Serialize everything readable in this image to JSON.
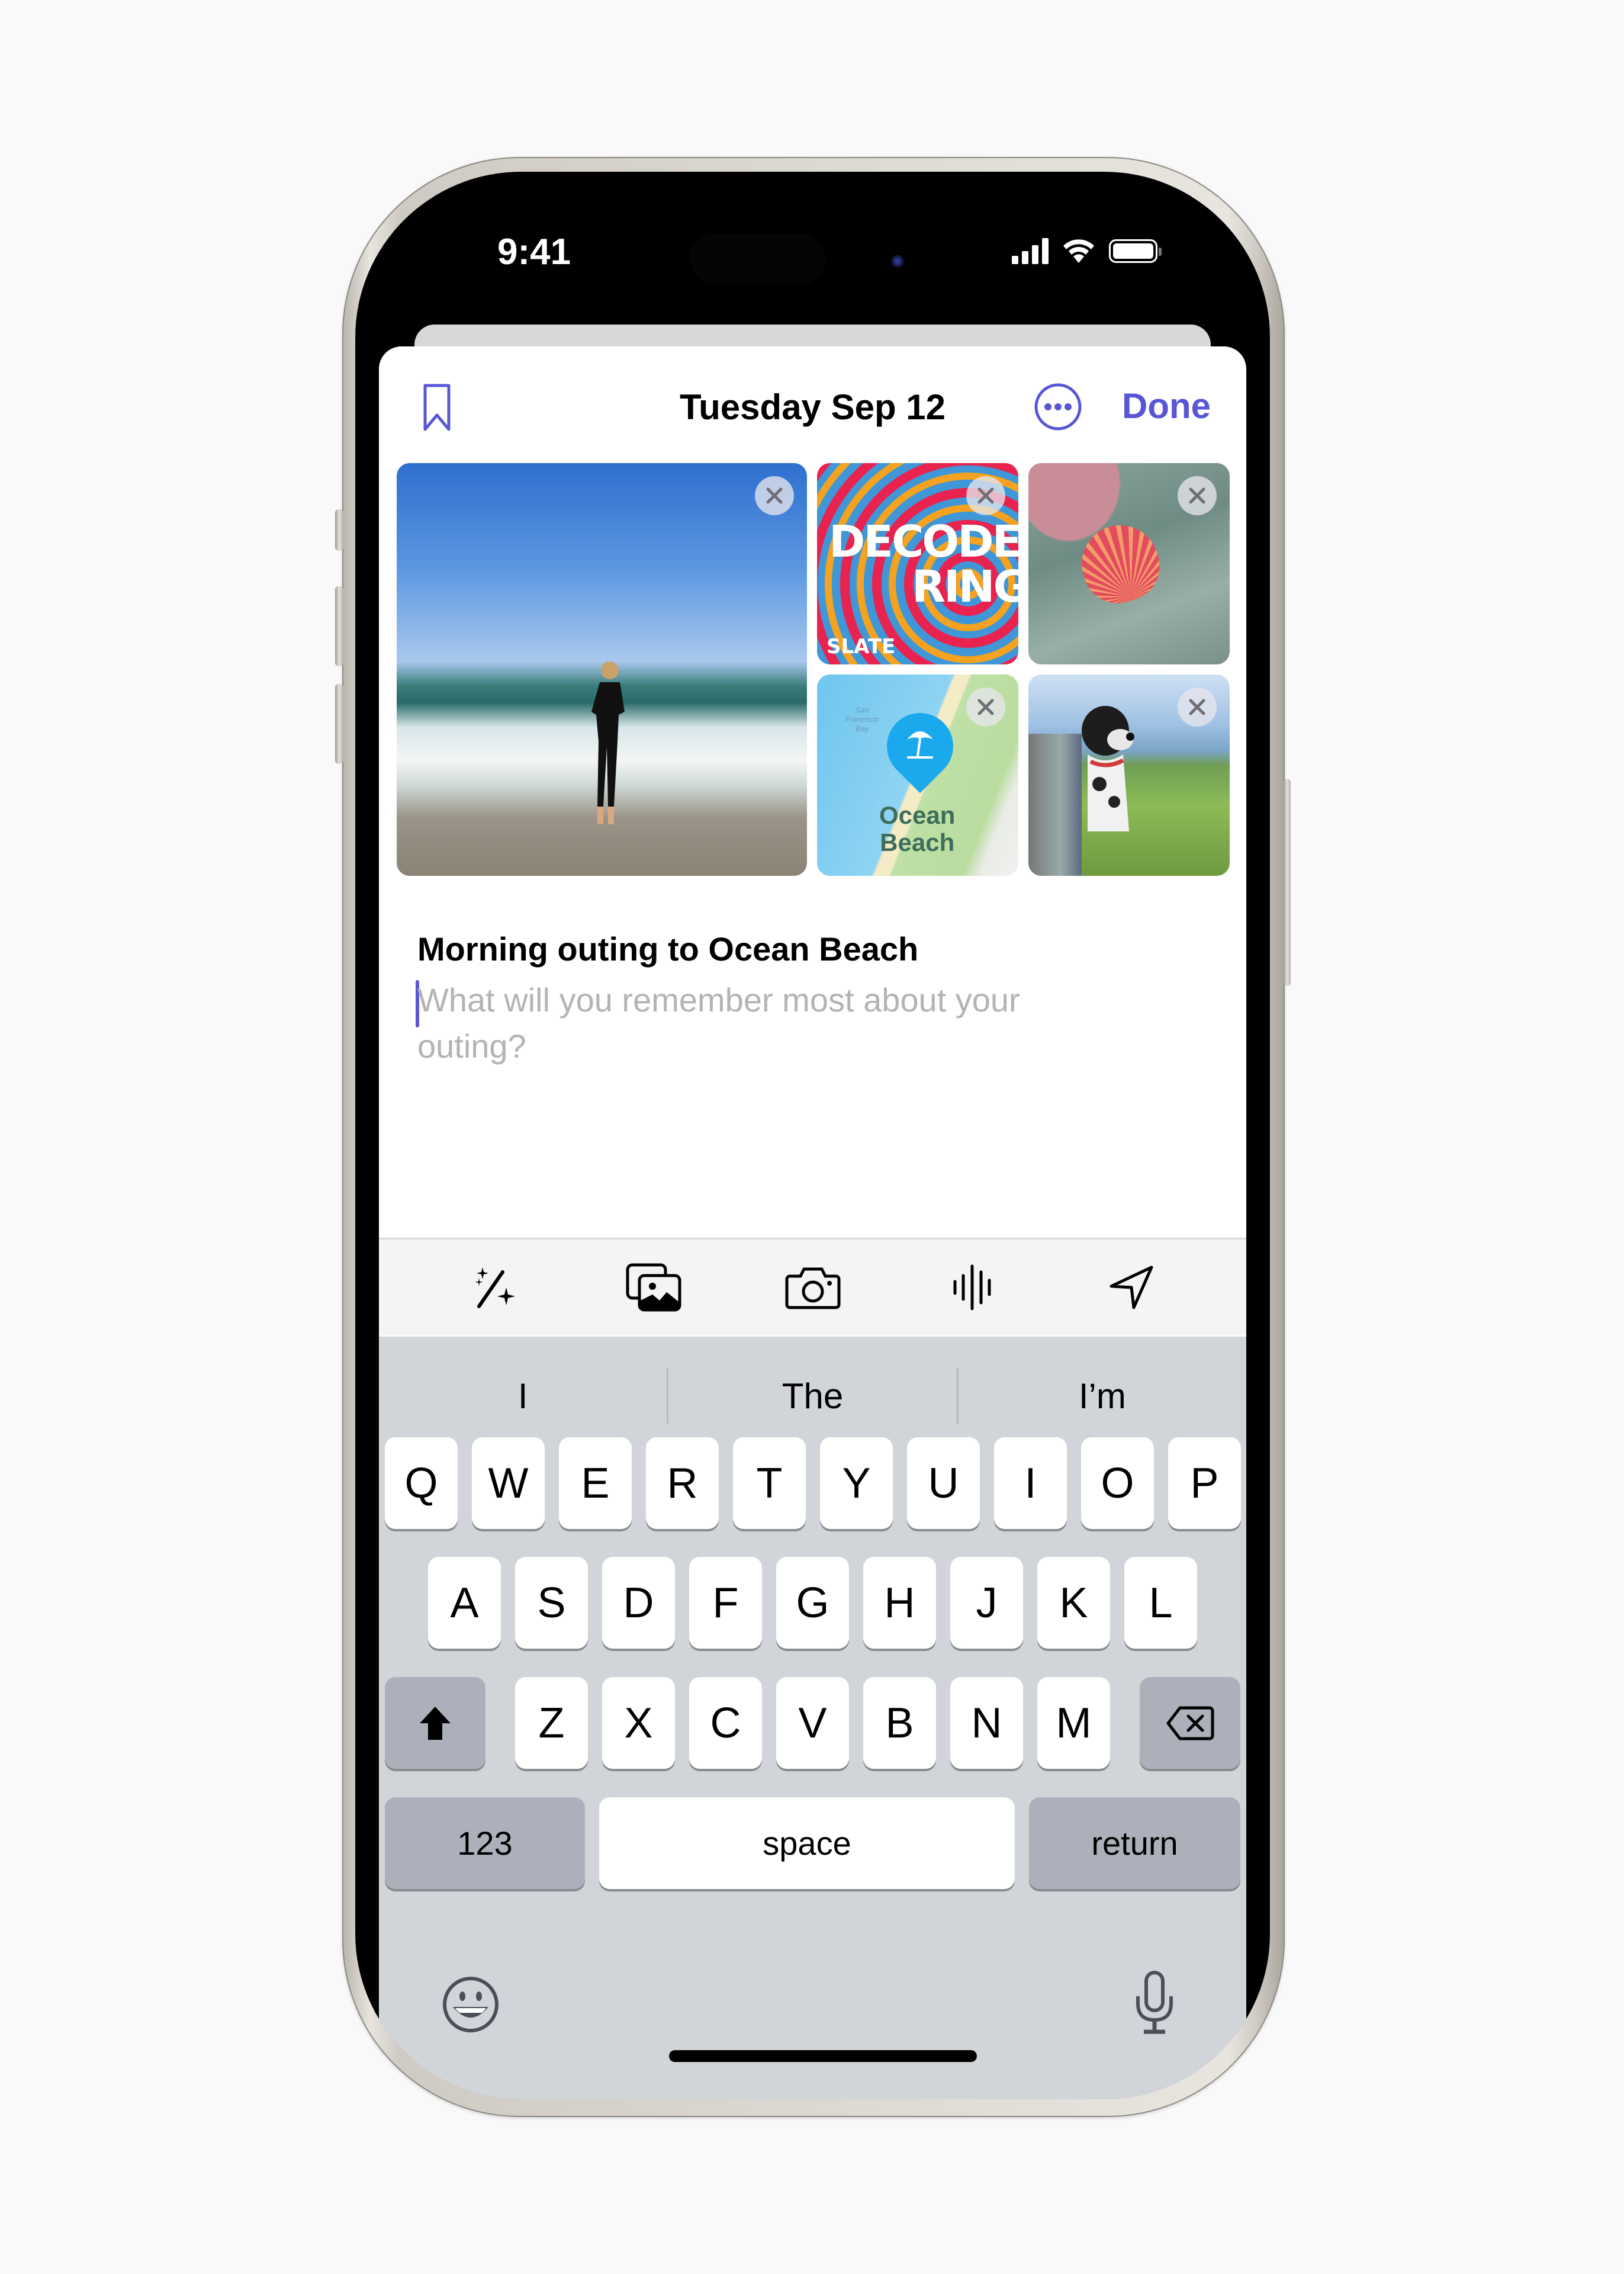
{
  "status_bar": {
    "time": "9:41",
    "signal_bars": 4,
    "wifi": "full",
    "battery_percent": 100
  },
  "header": {
    "bookmark_icon": "bookmark-icon",
    "title": "Tuesday Sep 12",
    "more_icon": "ellipsis-circle-icon",
    "done_label": "Done"
  },
  "accent_color": "#5856d6",
  "media": [
    {
      "kind": "photo",
      "description": "Person in wetsuit running out of the ocean onto the beach",
      "remove_icon": "close-icon"
    },
    {
      "kind": "podcast",
      "title_line1": "DECODER",
      "title_line2": "RING",
      "brand": "SLATE",
      "remove_icon": "close-icon"
    },
    {
      "kind": "photo",
      "description": "Pink scallop shell on a green towel",
      "remove_icon": "close-icon"
    },
    {
      "kind": "map",
      "bay_label_1": "San",
      "bay_label_2": "Francisco",
      "bay_label_3": "Bay",
      "place_line1": "Ocean",
      "place_line2": "Beach",
      "pin_icon": "beach-umbrella-icon",
      "remove_icon": "close-icon"
    },
    {
      "kind": "photo",
      "description": "Dog leaning out of car window by the coast",
      "remove_icon": "close-icon"
    }
  ],
  "entry": {
    "title": "Morning outing to Ocean Beach",
    "placeholder": "What will you remember most about your outing?"
  },
  "toolbar": [
    {
      "icon": "magic-wand-sparkles-icon",
      "label": "Suggestions"
    },
    {
      "icon": "photo-library-icon",
      "label": "Photos"
    },
    {
      "icon": "camera-icon",
      "label": "Camera"
    },
    {
      "icon": "audio-waveform-icon",
      "label": "Audio"
    },
    {
      "icon": "location-arrow-icon",
      "label": "Location"
    }
  ],
  "keyboard": {
    "predictions": [
      "I",
      "The",
      "I’m"
    ],
    "row1": [
      "Q",
      "W",
      "E",
      "R",
      "T",
      "Y",
      "U",
      "I",
      "O",
      "P"
    ],
    "row2": [
      "A",
      "S",
      "D",
      "F",
      "G",
      "H",
      "J",
      "K",
      "L"
    ],
    "row3": [
      "Z",
      "X",
      "C",
      "V",
      "B",
      "N",
      "M"
    ],
    "numbers_label": "123",
    "space_label": "space",
    "return_label": "return",
    "shift_icon": "shift-icon",
    "delete_icon": "delete-backward-icon",
    "emoji_icon": "emoji-icon",
    "mic_icon": "microphone-icon"
  }
}
